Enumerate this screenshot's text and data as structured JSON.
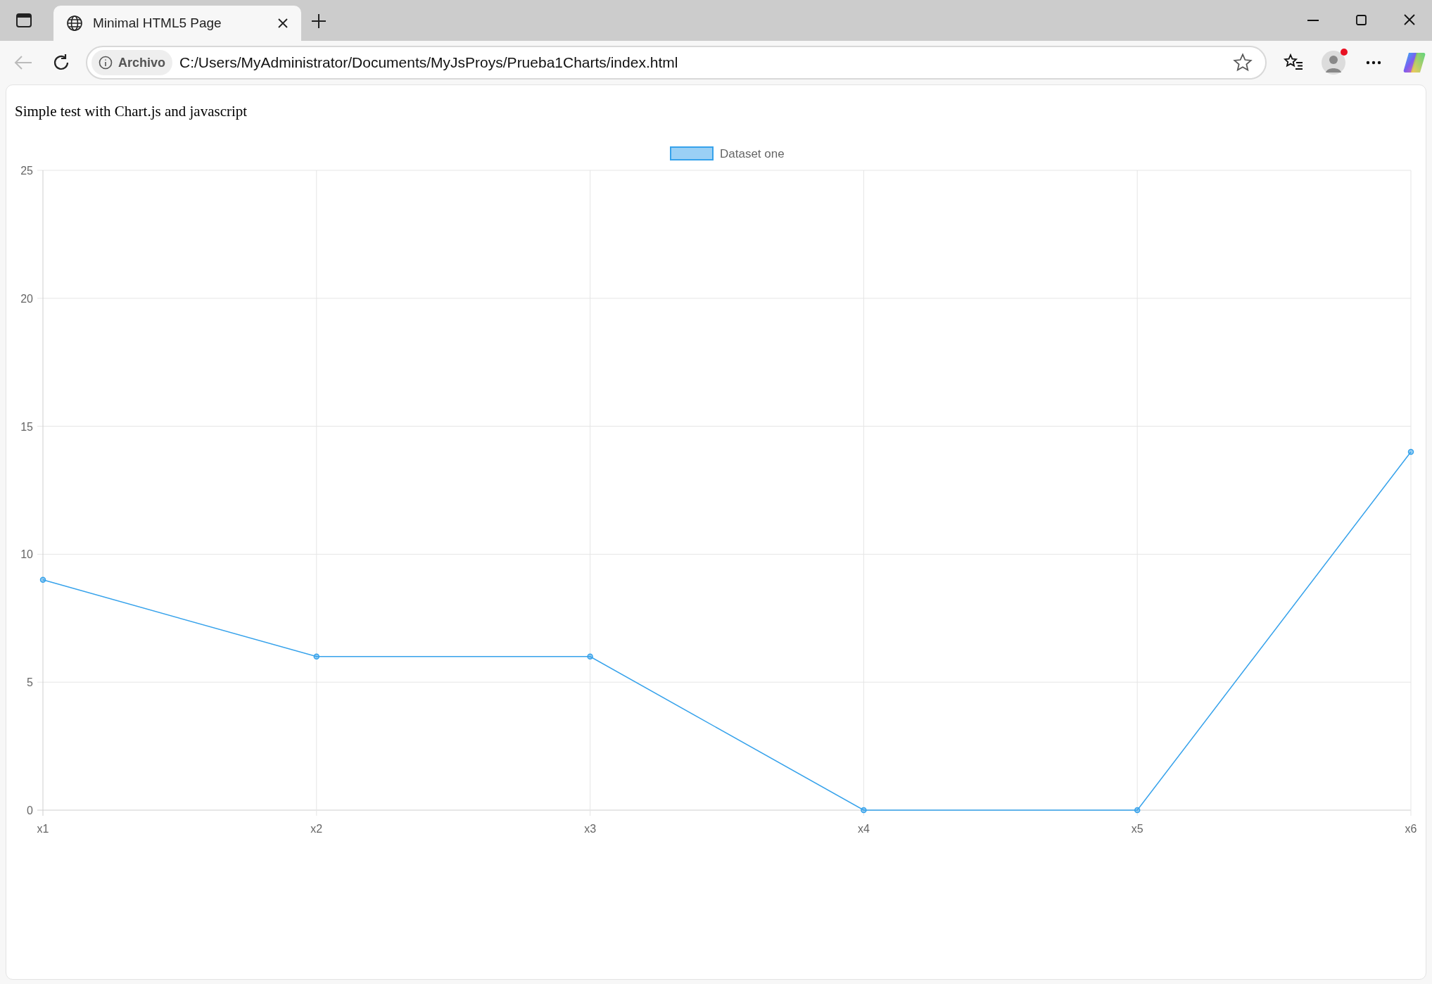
{
  "browser": {
    "tab": {
      "title": "Minimal HTML5 Page"
    },
    "address": {
      "badge": "Archivo",
      "url": "C:/Users/MyAdministrator/Documents/MyJsProys/Prueba1Charts/index.html"
    }
  },
  "page": {
    "heading": "Simple test with Chart.js and javascript",
    "chart_data": {
      "type": "line",
      "categories": [
        "x1",
        "x2",
        "x3",
        "x4",
        "x5",
        "x6"
      ],
      "series": [
        {
          "name": "Dataset one",
          "color": "#36a2eb",
          "marker": "circle",
          "values": [
            9,
            6,
            6,
            0,
            0,
            14
          ]
        }
      ],
      "grid": true,
      "ylim": [
        0,
        25
      ],
      "yticks": [
        0,
        5,
        10,
        15,
        20,
        25
      ]
    }
  }
}
